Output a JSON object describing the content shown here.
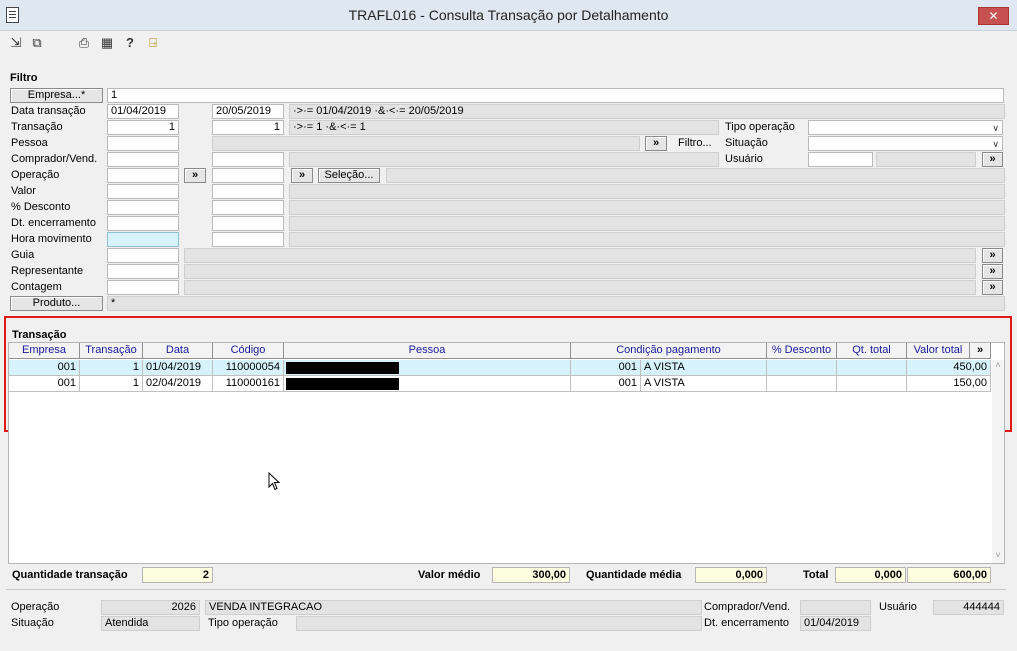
{
  "window": {
    "title": "TRAFL016 - Consulta Transação por Detalhamento",
    "close_label": "✕"
  },
  "toolbar": {
    "icons": [
      "goto-icon",
      "navigate-icon",
      "printer-icon",
      "calculator-icon",
      "help-icon",
      "exit-door-icon"
    ]
  },
  "filtro": {
    "group_label": "Filtro",
    "empresa_button": "Empresa...*",
    "empresa_value": "1",
    "labels": {
      "data_transacao": "Data transação",
      "transacao": "Transação",
      "pessoa": "Pessoa",
      "comprador": "Comprador/Vend.",
      "operacao": "Operação",
      "valor": "Valor",
      "desconto": "% Desconto",
      "dt_encerramento": "Dt. encerramento",
      "hora_movimento": "Hora movimento",
      "guia": "Guia",
      "representante": "Representante",
      "contagem": "Contagem"
    },
    "data_de": "01/04/2019",
    "data_ate": "20/05/2019",
    "data_expr": "·>·= 01/04/2019 ·&·<·= 20/05/2019",
    "transacao_de": "1",
    "transacao_ate": "1",
    "transacao_expr": "·>·= 1 ·&·<·= 1",
    "tipo_operacao_label": "Tipo operação",
    "situacao_label": "Situação",
    "usuario_label": "Usuário",
    "filtro_button": "Filtro...",
    "selecao_button": "Seleção...",
    "produto_button": "Produto...",
    "produto_value": "*",
    "more_glyph": "»"
  },
  "transacao": {
    "group_label": "Transação",
    "columns": [
      "Empresa",
      "Transação",
      "Data",
      "Código",
      "Pessoa",
      "Condição pagamento",
      "% Desconto",
      "Qt. total",
      "Valor total",
      "»"
    ],
    "rows": [
      {
        "empresa": "001",
        "transacao": "1",
        "data": "01/04/2019",
        "codigo": "110000054",
        "pessoa": "",
        "cond_cod": "001",
        "cond_desc": "A VISTA",
        "desconto": "",
        "qt_total": "",
        "valor_total": "450,00"
      },
      {
        "empresa": "001",
        "transacao": "1",
        "data": "02/04/2019",
        "codigo": "110000161",
        "pessoa": "",
        "cond_cod": "001",
        "cond_desc": "A VISTA",
        "desconto": "",
        "qt_total": "",
        "valor_total": "150,00"
      }
    ]
  },
  "summary": {
    "qtd_transacao_label": "Quantidade transação",
    "qtd_transacao": "2",
    "valor_medio_label": "Valor médio",
    "valor_medio": "300,00",
    "qtd_media_label": "Quantidade média",
    "qtd_media": "0,000",
    "total_label": "Total",
    "total_qtd": "0,000",
    "total_valor": "600,00"
  },
  "details": {
    "operacao_label": "Operação",
    "operacao_cod": "2026",
    "operacao_desc": "VENDA INTEGRACAO",
    "situacao_label": "Situação",
    "situacao": "Atendida",
    "tipo_operacao_label": "Tipo operação",
    "comprador_label": "Comprador/Vend.",
    "dt_encerramento_label": "Dt. encerramento",
    "dt_encerramento": "01/04/2019",
    "usuario_label": "Usuário",
    "usuario": "444444"
  }
}
